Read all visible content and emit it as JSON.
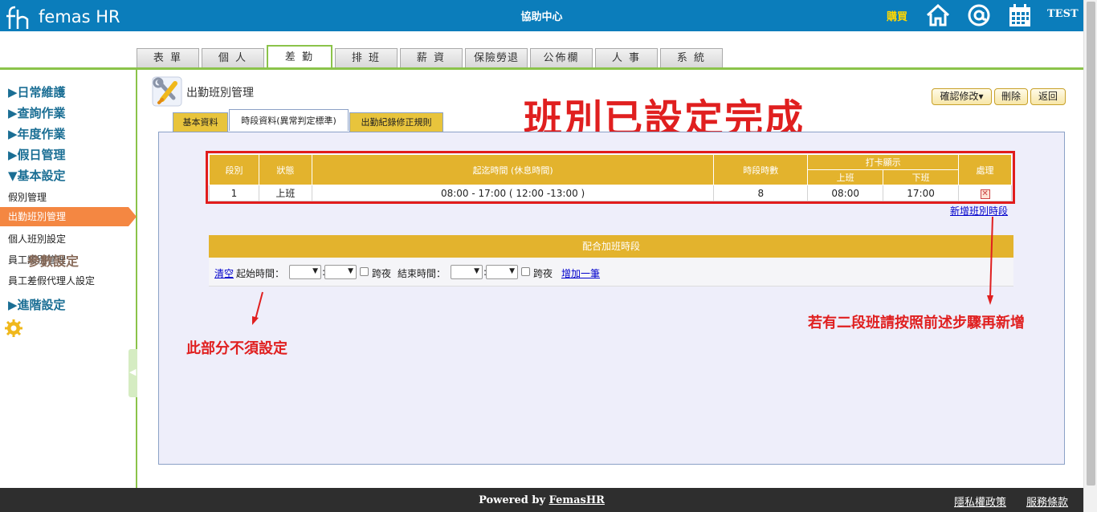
{
  "header": {
    "logo": "femas HR",
    "center_title": "協助中心",
    "buy": "購買",
    "user": "TEST",
    "icons": [
      "home-icon",
      "at-icon",
      "calendar-icon"
    ]
  },
  "tabs": [
    "表 單",
    "個 人",
    "差 勤",
    "排 班",
    "薪 資",
    "保險勞退",
    "公佈欄",
    "人 事",
    "系 統"
  ],
  "sidebar": {
    "groups": [
      "▶日常維護",
      "▶查詢作業",
      "▶年度作業",
      "▶假日管理",
      "▼基本設定"
    ],
    "items": [
      "假別管理",
      "出勤班別管理",
      "個人班別設定",
      "員工類別管理",
      "員工差假代理人設定"
    ],
    "advanced": "▶進階設定",
    "params": "參數設定"
  },
  "page": {
    "title": "出勤班別管理",
    "big_title": "班別已設定完成",
    "buttons": {
      "confirm": "確認修改▾",
      "delete": "刪除",
      "back": "返回"
    },
    "subtabs": [
      "基本資料",
      "時段資料(異常判定標準)",
      "出勤紀錄修正規則"
    ]
  },
  "shift_table": {
    "headers": {
      "seq": "段別",
      "status": "狀態",
      "time": "起迄時間 (休息時間)",
      "hours": "時段時數",
      "card": "打卡顯示",
      "card_in": "上班",
      "card_out": "下班",
      "action": "處理"
    },
    "rows": [
      {
        "seq": "1",
        "status": "上班",
        "time": "08:00 - 17:00 ( 12:00 -13:00 )",
        "hours": "8",
        "card_in": "08:00",
        "card_out": "17:00"
      }
    ],
    "add_link": "新增班別時段"
  },
  "overtime": {
    "title": "配合加班時段",
    "clear": "清空",
    "start_label": "起始時間：",
    "overnight": "跨夜",
    "end_label": "結束時間：",
    "add_one": "增加一筆"
  },
  "annotations": {
    "note_left": "此部分不須設定",
    "note_right": "若有二段班請按照前述步驟再新增"
  },
  "footer": {
    "powered_prefix": "Powered by ",
    "powered_brand": "FemasHR",
    "privacy": "隱私權政策",
    "terms": "服務條款"
  }
}
